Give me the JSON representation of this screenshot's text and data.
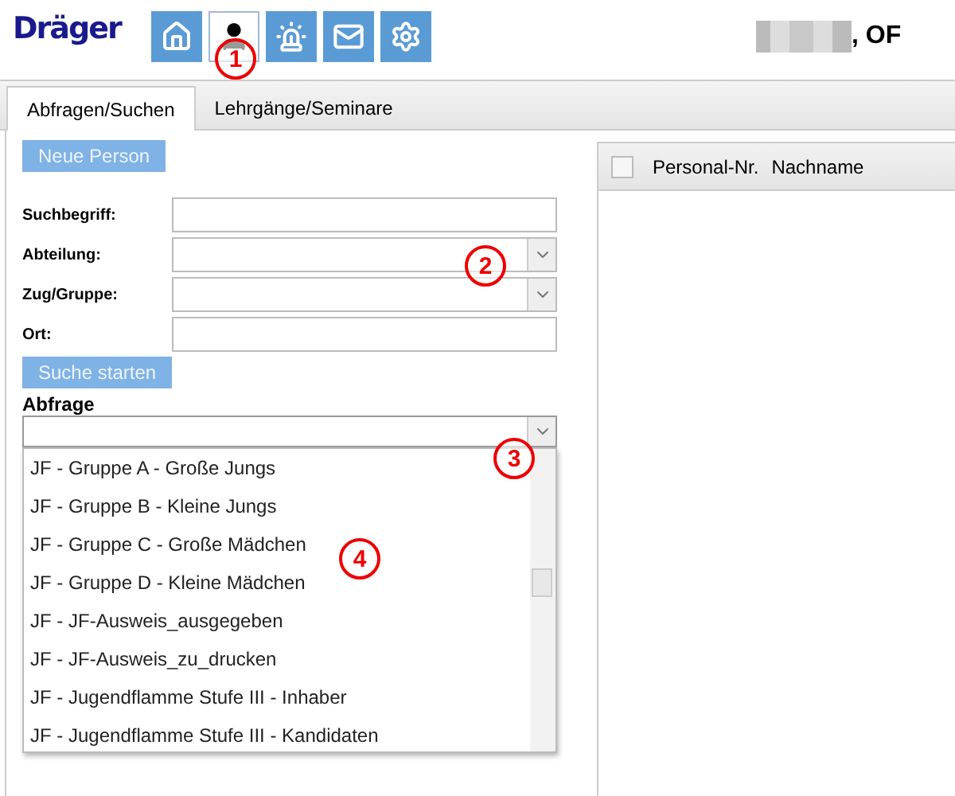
{
  "header": {
    "logo": "Dräger",
    "nav": [
      {
        "selected": false
      },
      {
        "selected": true
      },
      {
        "selected": false
      },
      {
        "selected": false
      },
      {
        "selected": false
      }
    ],
    "user_suffix": ", OF"
  },
  "tabs": [
    {
      "label": "Abfragen/Suchen",
      "selected": true
    },
    {
      "label": "Lehrgänge/Seminare",
      "selected": false
    }
  ],
  "new_button": "Neue Person",
  "fields": [
    {
      "label": "Suchbegriff:",
      "kind": "text"
    },
    {
      "label": "Abteilung:",
      "kind": "select"
    },
    {
      "label": "Zug/Gruppe:",
      "kind": "select"
    },
    {
      "label": "Ort:",
      "kind": "text"
    }
  ],
  "search_button": "Suche starten",
  "query": {
    "label": "Abfrage",
    "options": [
      "JF - Gruppe A - Große Jungs",
      "JF - Gruppe B - Kleine Jungs",
      "JF - Gruppe C - Große Mädchen",
      "JF - Gruppe D - Kleine Mädchen",
      "JF - JF-Ausweis_ausgegeben",
      "JF - JF-Ausweis_zu_drucken",
      "JF - Jugendflamme Stufe III - Inhaber",
      "JF - Jugendflamme Stufe III - Kandidaten"
    ]
  },
  "table": {
    "checked": false,
    "columns": [
      "Personal-Nr.",
      "Nachname"
    ]
  },
  "annotations": [
    "1",
    "2",
    "3",
    "4"
  ]
}
